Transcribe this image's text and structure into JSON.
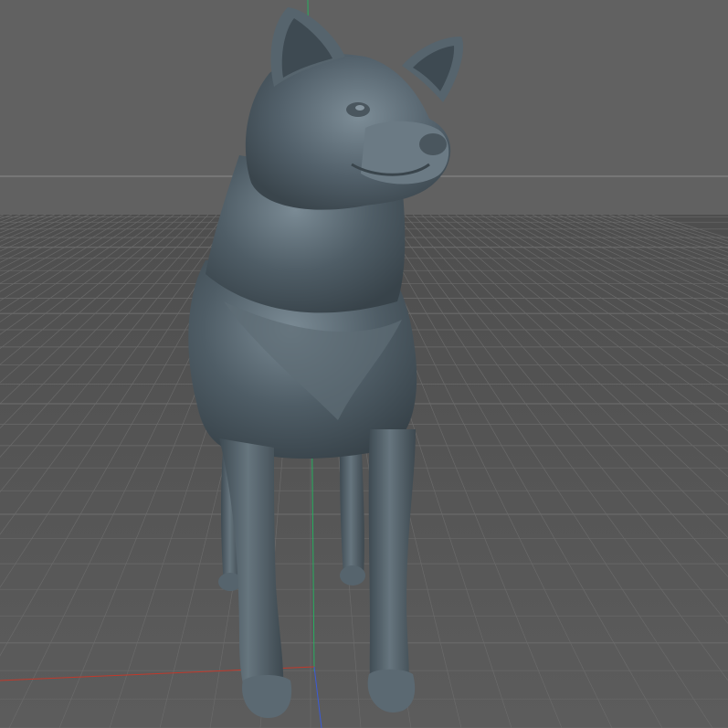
{
  "viewport": {
    "background": "#5f5f5f",
    "floor_color": "#555555",
    "grid_color": "#6a6a6a",
    "grid_major_color": "#777777",
    "horizon_color": "#8a8a8a",
    "axis_x_color": "#c0392b",
    "axis_y_color": "#27ae60",
    "axis_z_color": "#3b5bd6"
  },
  "model": {
    "name": "dog-sculpt-model",
    "base_color": "#4f5d66",
    "shadow_color": "#38434a",
    "highlight_color": "#7a8a94"
  }
}
